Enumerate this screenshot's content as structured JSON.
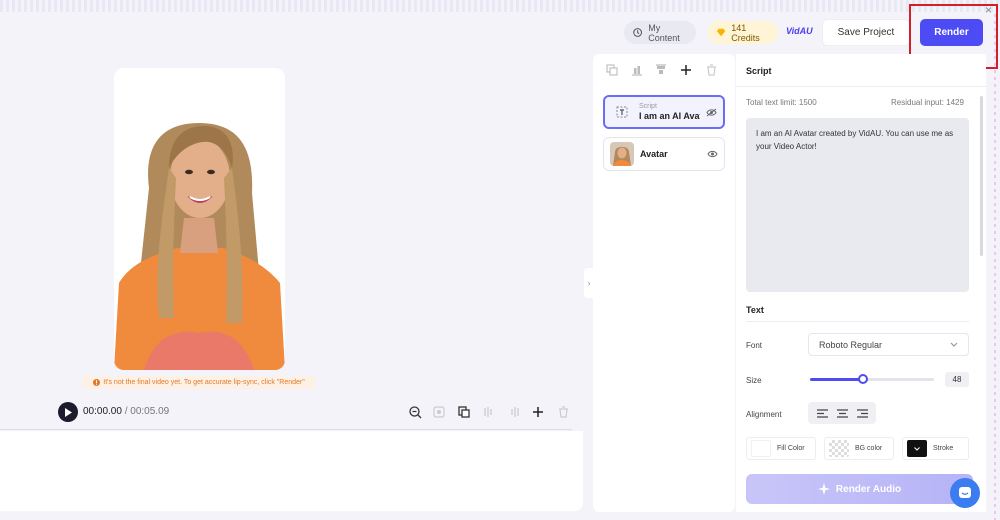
{
  "header": {
    "my_content_label": "My Content",
    "credits_label": "141 Credits",
    "brand_logo": "VidAU",
    "save_project_label": "Save Project",
    "render_label": "Render"
  },
  "preview": {
    "notice_text": "It's not the final video yet. To get accurate lip-sync, click \"Render\"",
    "current_time": "00:00.00",
    "separator": "/",
    "duration": "00:05.09"
  },
  "layers": {
    "items": [
      {
        "sub": "Script",
        "title": "I am an AI Avata...",
        "icon": "text-icon"
      },
      {
        "sub": "",
        "title": "Avatar",
        "icon": "avatar-thumbnail"
      }
    ]
  },
  "script": {
    "section_title": "Script",
    "total_limit_label": "Total text limit: 1500",
    "residual_label": "Residual input: 1429",
    "content": "I am an AI Avatar created by VidAU. You can use me as your Video Actor!"
  },
  "text_settings": {
    "section_title": "Text",
    "font_label": "Font",
    "font_value": "Roboto Regular",
    "size_label": "Size",
    "size_value": "48",
    "size_slider_fraction": 0.43,
    "alignment_label": "Alignment",
    "fill_color_label": "Fill Color",
    "bg_color_label": "BG color",
    "stroke_label": "Stroke"
  },
  "render_audio_label": "Render Audio",
  "colors": {
    "accent": "#4d4cf4",
    "highlight_border": "#d31f26",
    "notice": "#e07a2a"
  }
}
